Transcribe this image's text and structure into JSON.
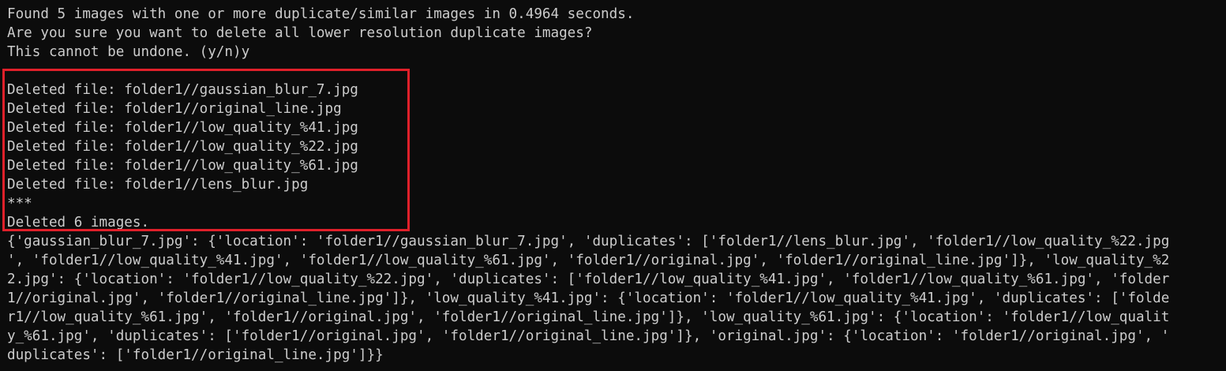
{
  "colors": {
    "background": "#0c0c0c",
    "text": "#cccccc",
    "highlight_border": "#e0202a"
  },
  "output": {
    "found_line": "Found 5 images with one or more duplicate/similar images in 0.4964 seconds.",
    "confirm_line_1": "Are you sure you want to delete all lower resolution duplicate images?",
    "confirm_line_2": "This cannot be undone. (y/n)y",
    "deleted_files": [
      "Deleted file: folder1//gaussian_blur_7.jpg",
      "Deleted file: folder1//original_line.jpg",
      "Deleted file: folder1//low_quality_%41.jpg",
      "Deleted file: folder1//low_quality_%22.jpg",
      "Deleted file: folder1//low_quality_%61.jpg",
      "Deleted file: folder1//lens_blur.jpg"
    ],
    "separator": "***",
    "deleted_summary": "Deleted 6 images.",
    "dict_lines": [
      "{'gaussian_blur_7.jpg': {'location': 'folder1//gaussian_blur_7.jpg', 'duplicates': ['folder1//lens_blur.jpg', 'folder1//low_quality_%22.jpg",
      "', 'folder1//low_quality_%41.jpg', 'folder1//low_quality_%61.jpg', 'folder1//original.jpg', 'folder1//original_line.jpg']}, 'low_quality_%2",
      "2.jpg': {'location': 'folder1//low_quality_%22.jpg', 'duplicates': ['folder1//low_quality_%41.jpg', 'folder1//low_quality_%61.jpg', 'folder",
      "1//original.jpg', 'folder1//original_line.jpg']}, 'low_quality_%41.jpg': {'location': 'folder1//low_quality_%41.jpg', 'duplicates': ['folde",
      "r1//low_quality_%61.jpg', 'folder1//original.jpg', 'folder1//original_line.jpg']}, 'low_quality_%61.jpg': {'location': 'folder1//low_qualit",
      "y_%61.jpg', 'duplicates': ['folder1//original.jpg', 'folder1//original_line.jpg']}, 'original.jpg': {'location': 'folder1//original.jpg', '",
      "duplicates': ['folder1//original_line.jpg']}}"
    ]
  }
}
